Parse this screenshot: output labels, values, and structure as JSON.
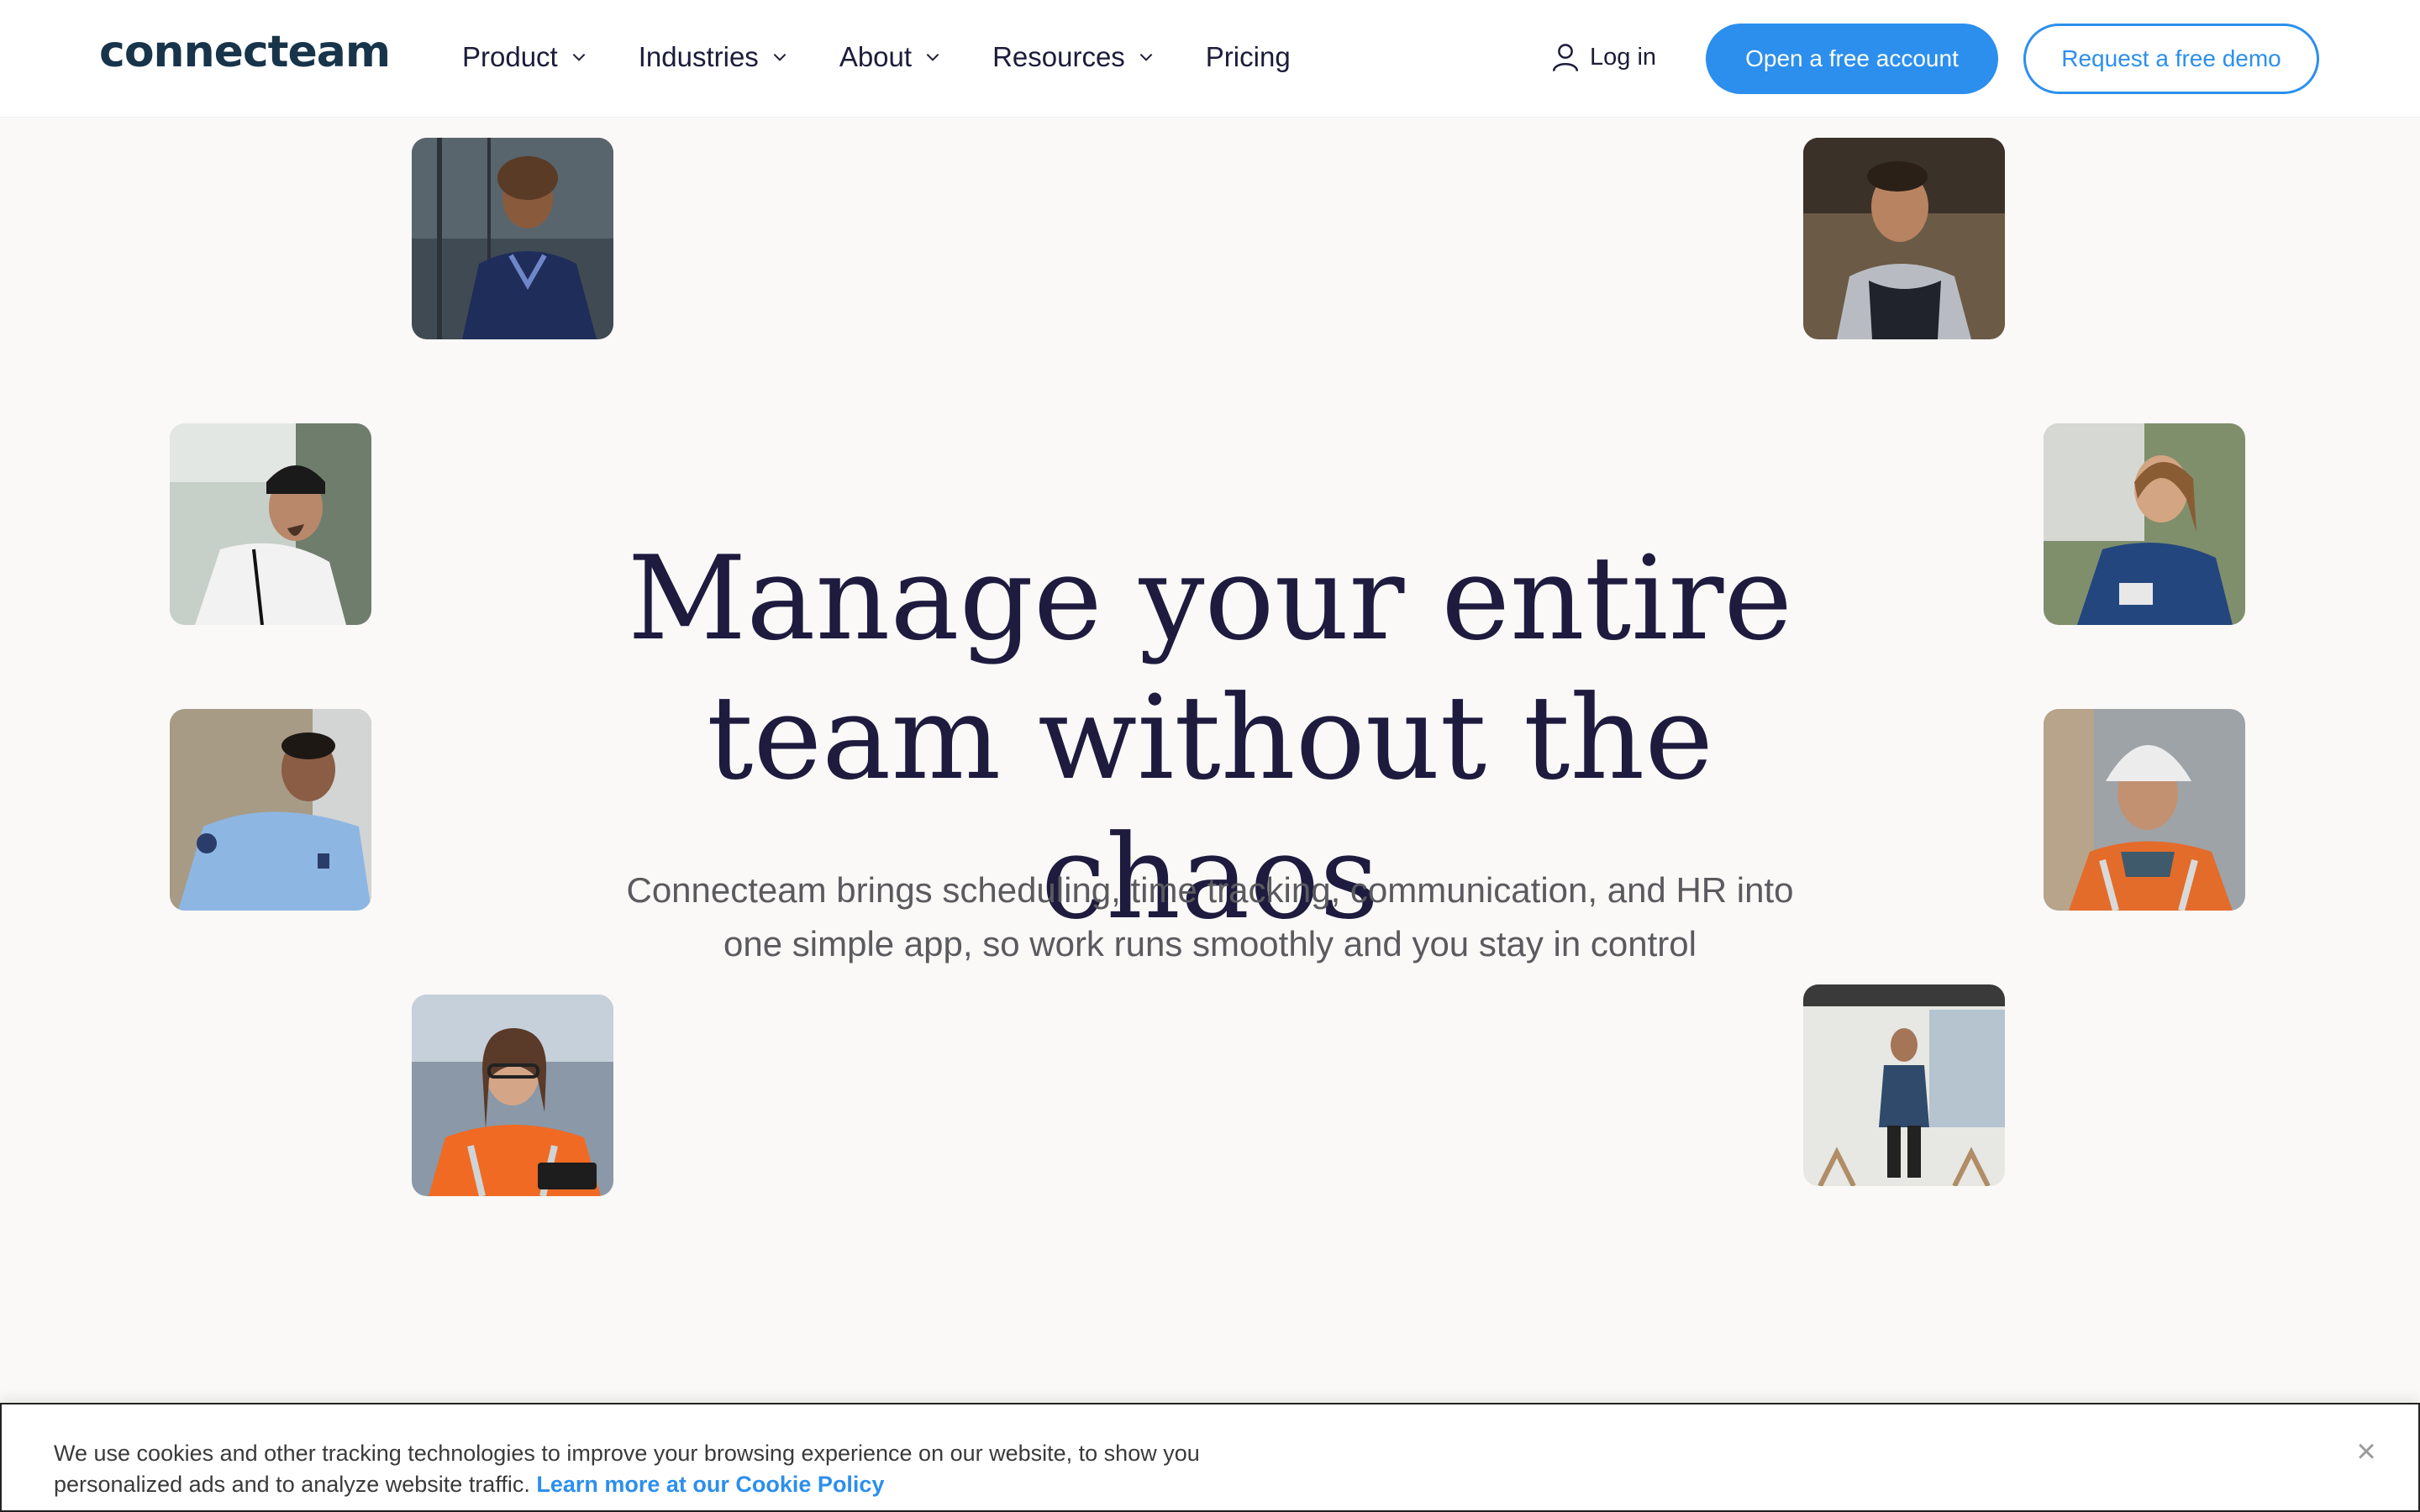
{
  "header": {
    "logo": "connecteam",
    "nav": [
      {
        "label": "Product",
        "has_dropdown": true
      },
      {
        "label": "Industries",
        "has_dropdown": true
      },
      {
        "label": "About",
        "has_dropdown": true
      },
      {
        "label": "Resources",
        "has_dropdown": true
      },
      {
        "label": "Pricing",
        "has_dropdown": false
      }
    ],
    "login_label": "Log in",
    "login_icon": "user-icon",
    "primary_cta": "Open a free account",
    "secondary_cta": "Request a free demo"
  },
  "hero": {
    "title_line1": "Manage your entire",
    "title_line2": "team without the chaos",
    "subtitle_line1": "Connecteam brings scheduling, time tracking, communication, and HR into",
    "subtitle_line2": "one simple app, so work runs smoothly and you stay in control"
  },
  "photos": [
    {
      "name": "photo-nurse-office",
      "subject": "nurse in scrubs"
    },
    {
      "name": "photo-chef-apron",
      "subject": "smiling cook in apron"
    },
    {
      "name": "photo-worker-beanie",
      "subject": "worker in beanie with lanyard"
    },
    {
      "name": "photo-nurse-outdoor",
      "subject": "nurse with badge outdoors"
    },
    {
      "name": "photo-security-officer",
      "subject": "officer in light blue shirt"
    },
    {
      "name": "photo-construction-hardhat",
      "subject": "construction worker with hard hat"
    },
    {
      "name": "photo-warehouse-woman",
      "subject": "woman in hi-vis jacket with tablet"
    },
    {
      "name": "photo-man-office-space",
      "subject": "man walking in empty office"
    }
  ],
  "cookie": {
    "text_line1": "We use cookies and other tracking technologies to improve your browsing experience on our website, to show you",
    "text_line2": "personalized ads and to analyze website traffic.",
    "link": "Learn more at our Cookie Policy",
    "close": "×"
  },
  "colors": {
    "accent": "#2c8fed",
    "title": "#1e1b3f",
    "logo": "#17344a",
    "background": "#faf9f7"
  }
}
